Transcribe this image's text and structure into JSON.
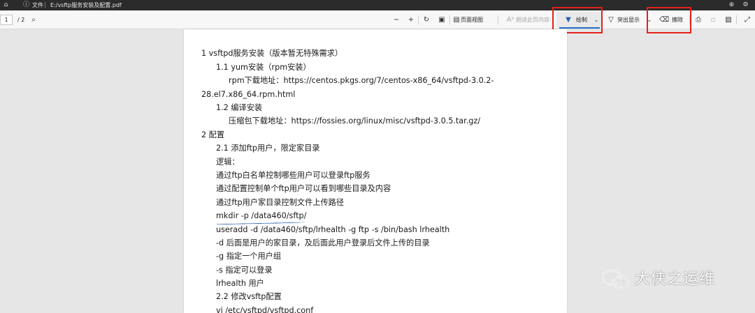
{
  "addressbar": {
    "file_label": "文件",
    "path": "E:/vsftp服务安装及配置.pdf"
  },
  "toolbar": {
    "page_current": "1",
    "page_total": "/ 2",
    "page_view_label": "页面视图",
    "read_aloud_label": "朗读此页内容",
    "draw_label": "绘制",
    "highlight_label": "突出显示",
    "erase_label": "擦除"
  },
  "document": {
    "lines": [
      "1 vsftpd服务安装（版本暂无特殊需求）",
      "1.1 yum安装（rpm安装）",
      "rpm下载地址：https://centos.pkgs.org/7/centos-x86_64/vsftpd-3.0.2-",
      "28.el7.x86_64.rpm.html",
      "1.2 编译安装",
      "压缩包下载地址：https://fossies.org/linux/misc/vsftpd-3.0.5.tar.gz/",
      "2 配置",
      "2.1 添加ftp用户，限定家目录",
      "逻辑：",
      "通过ftp白名单控制哪些用户可以登录ftp服务",
      "通过配置控制单个ftp用户可以看到哪些目录及内容",
      "通过ftp用户家目录控制文件上传路径",
      "mkdir -p /data460/sftp/",
      "useradd -d /data460/sftp/lrhealth -g ftp -s /bin/bash lrhealth",
      "-d 后面是用户的家目录，及后面此用户登录后文件上传的目录",
      "-g 指定一个用户组",
      "-s 指定可以登录",
      "lrhealth 用户",
      "2.2 修改vsftp配置",
      "vi /etc/vsftpd/vsftpd.conf"
    ]
  },
  "watermark": {
    "text": "大侠之运维"
  },
  "colors": {
    "highlight_box": "#e3201b",
    "ink_underline": "#2b5fb8",
    "active_tab_underline": "#2a6fc6"
  }
}
